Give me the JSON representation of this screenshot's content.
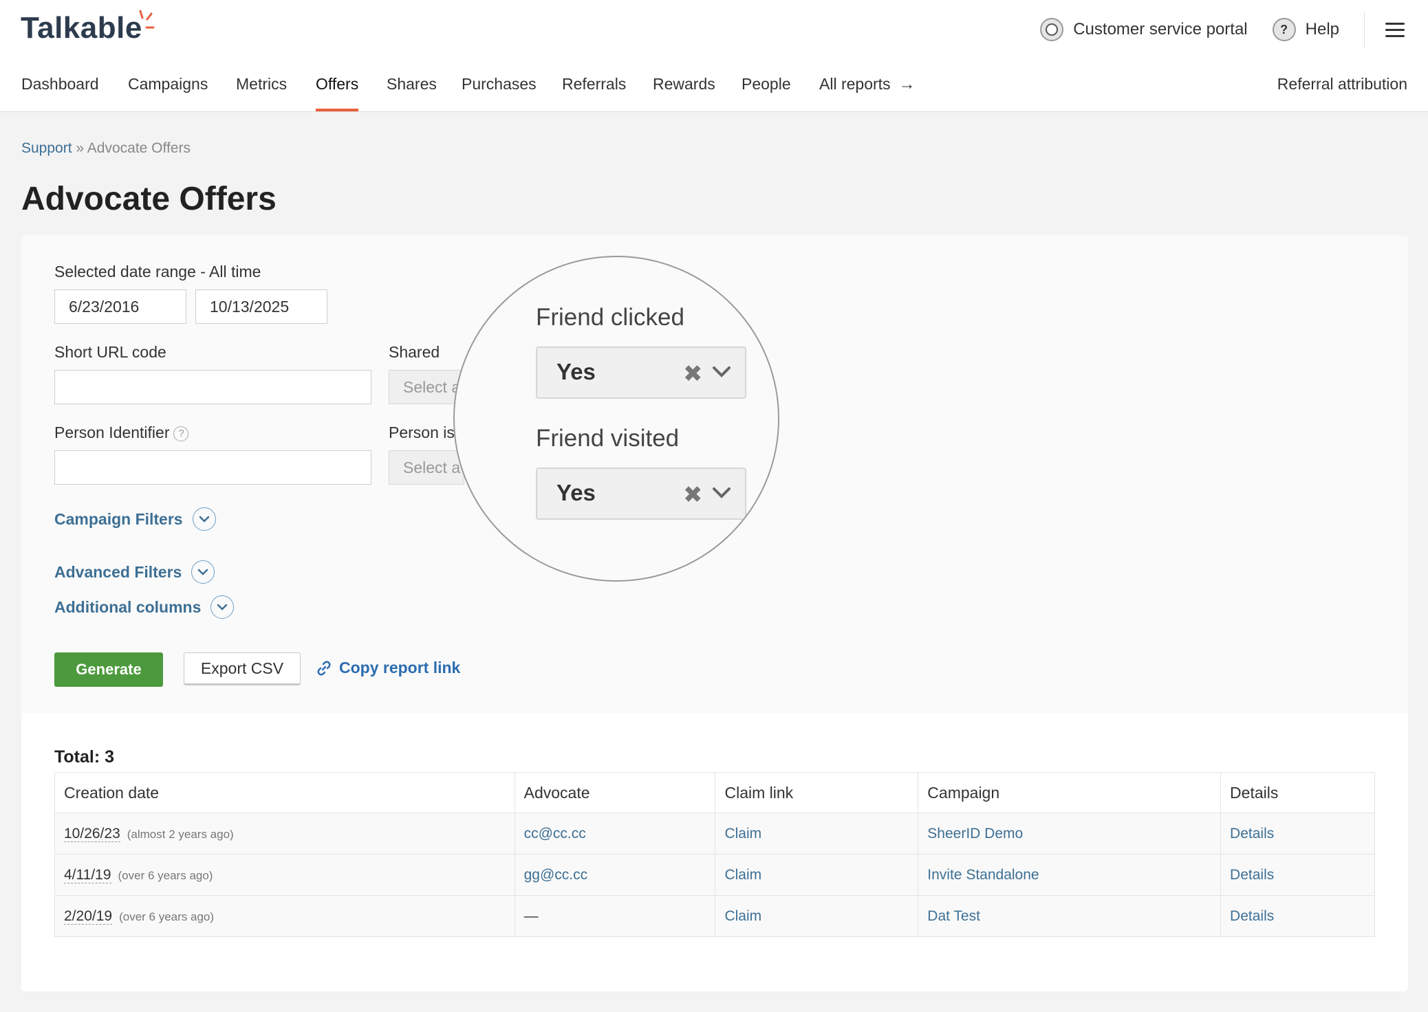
{
  "header": {
    "logo": "Talkable",
    "customer_portal": "Customer service portal",
    "help": "Help"
  },
  "nav": {
    "items": [
      "Dashboard",
      "Campaigns",
      "Metrics",
      "Offers",
      "Shares",
      "Purchases",
      "Referrals",
      "Rewards",
      "People",
      "All reports"
    ],
    "active": "Offers",
    "right_item": "Referral attribution"
  },
  "breadcrumb": {
    "parent": "Support",
    "separator": "»",
    "current": "Advocate Offers"
  },
  "page_title": "Advocate Offers",
  "filters": {
    "date_range_label": "Selected date range - All time",
    "date_from": "6/23/2016",
    "date_to": "10/13/2025",
    "short_url_label": "Short URL code",
    "short_url_value": "",
    "shared_label": "Shared",
    "shared_placeholder": "Select a",
    "person_identifier_label": "Person Identifier",
    "person_identifier_value": "",
    "person_is_label": "Person is",
    "person_is_placeholder": "Select a",
    "campaign_filters": "Campaign Filters",
    "advanced_filters": "Advanced Filters",
    "additional_columns": "Additional columns"
  },
  "magnifier": {
    "friend_clicked_label": "Friend clicked",
    "friend_clicked_value": "Yes",
    "friend_visited_label": "Friend visited",
    "friend_visited_value": "Yes",
    "clear_glyph": "✖"
  },
  "actions": {
    "generate": "Generate",
    "export_csv": "Export CSV",
    "copy_report_link": "Copy report link"
  },
  "results": {
    "total": "Total: 3",
    "columns": [
      "Creation date",
      "Advocate",
      "Claim link",
      "Campaign",
      "Details"
    ],
    "rows": [
      {
        "date": "10/26/23",
        "ago": "(almost 2 years ago)",
        "advocate": "cc@cc.cc",
        "claim": "Claim",
        "campaign": "SheerID Demo",
        "details": "Details"
      },
      {
        "date": "4/11/19",
        "ago": "(over 6 years ago)",
        "advocate": "gg@cc.cc",
        "claim": "Claim",
        "campaign": "Invite Standalone",
        "details": "Details"
      },
      {
        "date": "2/20/19",
        "ago": "(over 6 years ago)",
        "advocate": "—",
        "claim": "Claim",
        "campaign": "Dat Test",
        "details": "Details"
      }
    ]
  },
  "colors": {
    "accent": "#e8603c",
    "link": "#3d6f94",
    "primary_button": "#4c9a3d"
  }
}
